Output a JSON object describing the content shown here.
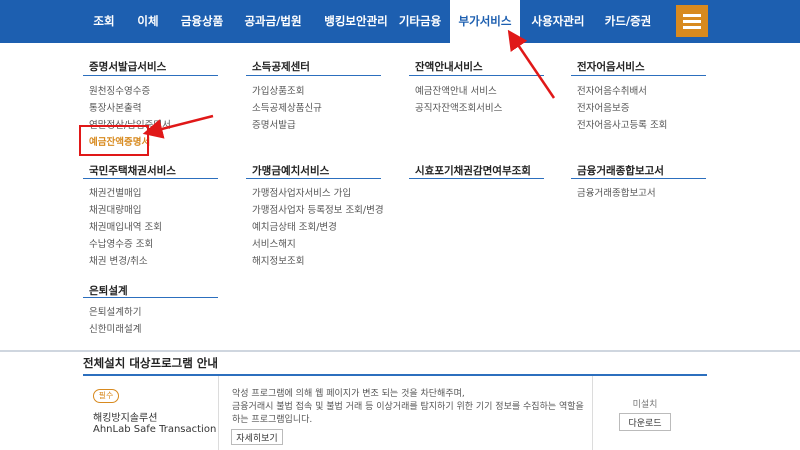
{
  "nav": {
    "items": [
      "조회",
      "이체",
      "금융상품",
      "공과금/법원",
      "뱅킹보안관리",
      "기타금융",
      "부가서비스",
      "사용자관리",
      "카드/증권"
    ],
    "active_index": 6,
    "menu_icon": "hamburger-menu-icon"
  },
  "menu": {
    "columns": [
      {
        "title": "증명서발급서비스",
        "items": [
          "원천징수영수증",
          "통장사본출력",
          "연말정산/납입증명서",
          "예금잔액증명서"
        ]
      },
      {
        "title": "소득공제센터",
        "items": [
          "가입상품조회",
          "소득공제상품신규",
          "증명서발급"
        ]
      },
      {
        "title": "잔액안내서비스",
        "items": [
          "예금잔액안내 서비스",
          "공직자잔액조회서비스"
        ]
      },
      {
        "title": "전자어음서비스",
        "items": [
          "전자어음수취배서",
          "전자어음보증",
          "전자어음사고등록 조회"
        ]
      },
      {
        "title": "국민주택채권서비스",
        "items": [
          "채권건별매입",
          "채권대량매입",
          "채권매입내역 조회",
          "수납영수증 조회",
          "채권 변경/취소"
        ]
      },
      {
        "title": "가맹금예치서비스",
        "items": [
          "가맹점사업자서비스 가입",
          "가맹점사업자 등록정보 조회/변경",
          "예치금상태 조회/변경",
          "서비스해지",
          "해지정보조회"
        ]
      },
      {
        "title": "시효포기채권감면여부조회",
        "items": []
      },
      {
        "title": "금융거래종합보고서",
        "items": [
          "금융거래종합보고서"
        ]
      },
      {
        "title": "은퇴설계",
        "items": [
          "은퇴설계하기",
          "신한미래설계"
        ]
      }
    ]
  },
  "programs": {
    "title": "전체설치 대상프로그램 안내",
    "badge": "필수",
    "name": "해킹방지솔루션",
    "name_en": "AhnLab Safe Transaction",
    "desc": [
      "악성 프로그램에 의해 웹 페이지가 변조 되는 것을 차단해주며,",
      "금융거래시 불법 접속 및 불법 거래 등 이상거래를 탐지하기 위한 기기 정보를 수집하는 역할을",
      "하는 프로그램입니다."
    ],
    "details_button": "자세히보기",
    "status": "미설치",
    "download_button": "다운로드"
  },
  "colors": {
    "nav_bg": "#1d5fb0",
    "accent": "#d88a1f",
    "annotation": "#e01818"
  }
}
